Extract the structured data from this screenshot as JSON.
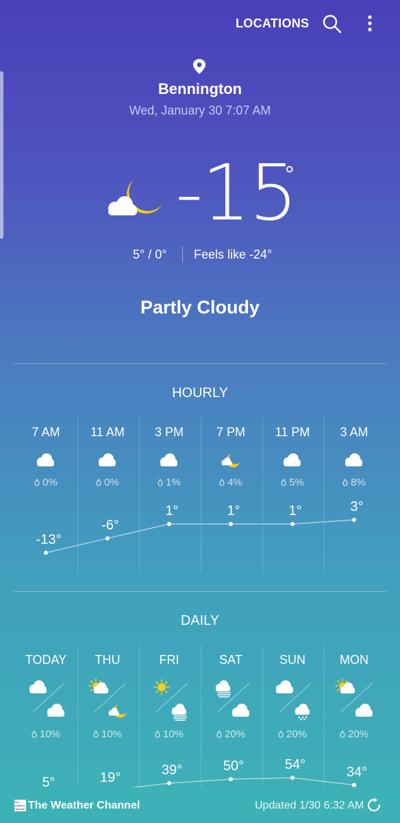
{
  "header": {
    "locations_label": "LOCATIONS",
    "search_icon": "search-icon",
    "menu_icon": "more-vert-icon"
  },
  "current": {
    "city": "Bennington",
    "datetime": "Wed, January 30 7:07 AM",
    "temperature": "-15",
    "unit": "°",
    "icon": "partly-cloudy-night-icon",
    "high_low": "5°  /  0°",
    "feels_like": "Feels like -24°",
    "condition": "Partly Cloudy"
  },
  "hourly": {
    "title": "HOURLY",
    "items": [
      {
        "time": "7 AM",
        "icon": "cloud-icon",
        "precip": "0%",
        "temp_label": "-13°",
        "temp": -13
      },
      {
        "time": "11 AM",
        "icon": "cloud-icon",
        "precip": "0%",
        "temp_label": "-6°",
        "temp": -6
      },
      {
        "time": "3 PM",
        "icon": "cloud-icon",
        "precip": "1%",
        "temp_label": "1°",
        "temp": 1
      },
      {
        "time": "7 PM",
        "icon": "partly-cloudy-night-icon",
        "precip": "4%",
        "temp_label": "1°",
        "temp": 1
      },
      {
        "time": "11 PM",
        "icon": "cloud-icon",
        "precip": "5%",
        "temp_label": "1°",
        "temp": 1
      },
      {
        "time": "3 AM",
        "icon": "cloud-icon",
        "precip": "8%",
        "temp_label": "3°",
        "temp": 3
      }
    ]
  },
  "daily": {
    "title": "DAILY",
    "items": [
      {
        "day": "TODAY",
        "day_icon": "cloud-icon",
        "night_icon": "cloud-icon",
        "precip": "10%",
        "high_label": "5°",
        "high": 5
      },
      {
        "day": "THU",
        "day_icon": "partly-sunny-icon",
        "night_icon": "partly-cloudy-night-icon",
        "precip": "10%",
        "high_label": "19°",
        "high": 19
      },
      {
        "day": "FRI",
        "day_icon": "sun-icon",
        "night_icon": "fog-icon",
        "precip": "10%",
        "high_label": "39°",
        "high": 39
      },
      {
        "day": "SAT",
        "day_icon": "fog-icon",
        "night_icon": "cloud-icon",
        "precip": "20%",
        "high_label": "50°",
        "high": 50
      },
      {
        "day": "SUN",
        "day_icon": "cloud-icon",
        "night_icon": "snow-rain-icon",
        "precip": "20%",
        "high_label": "54°",
        "high": 54
      },
      {
        "day": "MON",
        "day_icon": "partly-sunny-icon",
        "night_icon": "cloud-icon",
        "precip": "20%",
        "high_label": "34°",
        "high": 34
      }
    ]
  },
  "footer": {
    "brand": "The Weather Channel",
    "logo_text": "The Weather Channel",
    "updated": "Updated  1/30  6:32 AM",
    "refresh_icon": "refresh-icon"
  }
}
